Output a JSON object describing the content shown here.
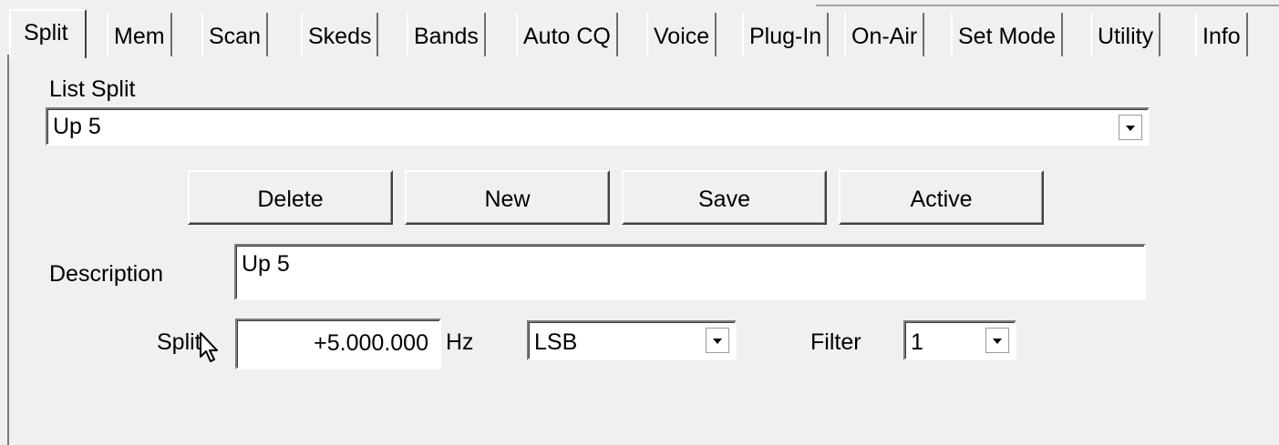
{
  "tabs": [
    {
      "label": "Split",
      "active": true
    },
    {
      "label": "Mem"
    },
    {
      "label": "Scan"
    },
    {
      "label": "Skeds"
    },
    {
      "label": "Bands"
    },
    {
      "label": "Auto CQ"
    },
    {
      "label": "Voice"
    },
    {
      "label": "Plug-In"
    },
    {
      "label": "On-Air"
    },
    {
      "label": "Set Mode"
    },
    {
      "label": "Utility"
    },
    {
      "label": "Info"
    }
  ],
  "list_split": {
    "label": "List Split",
    "value": "Up 5"
  },
  "buttons": {
    "delete": "Delete",
    "new": "New",
    "save": "Save",
    "active": "Active"
  },
  "description": {
    "label": "Description",
    "value": "Up 5"
  },
  "split": {
    "label": "Split",
    "value": "+5.000.000",
    "unit": "Hz"
  },
  "mode": {
    "value": "LSB"
  },
  "filter": {
    "label": "Filter",
    "value": "1"
  },
  "icons": {
    "cursor": "mouse-pointer-icon",
    "dropdown": "chevron-down-icon"
  }
}
